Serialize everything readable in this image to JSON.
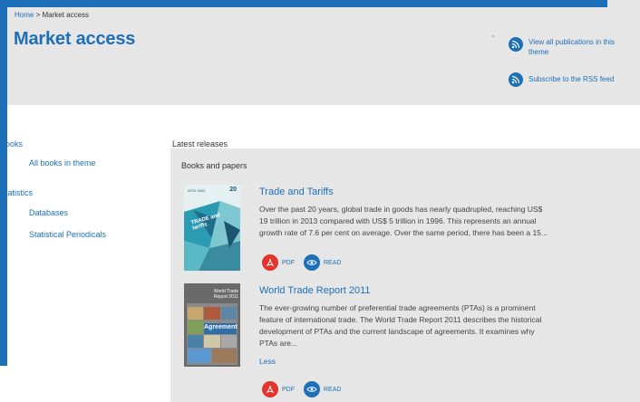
{
  "header": {
    "breadcrumb_home": "Home",
    "breadcrumb_sep": ">",
    "breadcrumb_current": "Market access",
    "title": "Market access",
    "links": [
      {
        "label": "View all publications in this theme",
        "icon": "rss-icon"
      },
      {
        "label": "Subscribe to the RSS feed",
        "icon": "rss-icon"
      }
    ]
  },
  "sidebar": {
    "sections": [
      {
        "heading": "Books",
        "items": [
          "All books in theme"
        ]
      },
      {
        "heading": "Statistics",
        "items": [
          "Databases",
          "Statistical Periodicals"
        ]
      }
    ]
  },
  "main": {
    "section_title": "Latest releases",
    "panel_title": "Books and papers",
    "publications": [
      {
        "title": "Trade and Tariffs",
        "description": "Over the past 20 years, global trade in goods has nearly quadrupled, reaching US$ 19 trillion in 2013 compared with US$ 5 trillion in 1996. This represents an annual growth rate of 7.6 per cent on average. Over the same period, there has been a 15...",
        "pdf_label": "PDF",
        "read_label": "READ",
        "cover_logo": "WTO OMC",
        "cover_badge": "20",
        "cover_title": "TRADE and tariffs"
      },
      {
        "title": "World Trade Report 2011",
        "description": "The ever-growing number of preferential trade agreements (PTAs) is a prominent feature of international trade. The World Trade Report 2011 describes the historical development of PTAs and the current landscape of agreements. It examines why PTAs are...",
        "less_label": "Less",
        "pdf_label": "PDF",
        "read_label": "READ",
        "cover_title": "World Trade Report 2011",
        "cover_word": "Agreement"
      }
    ]
  },
  "colors": {
    "accent": "#1d6fb8",
    "panel_bg": "#e6e6e6",
    "pdf_red": "#e2342a"
  }
}
